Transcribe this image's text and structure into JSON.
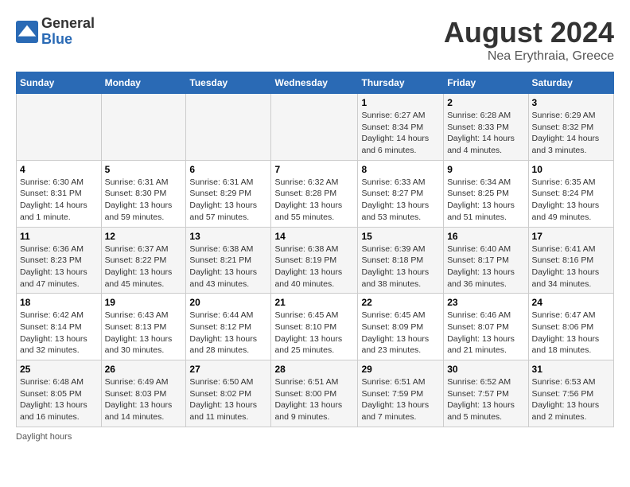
{
  "logo": {
    "general": "General",
    "blue": "Blue"
  },
  "title": "August 2024",
  "subtitle": "Nea Erythraia, Greece",
  "days_of_week": [
    "Sunday",
    "Monday",
    "Tuesday",
    "Wednesday",
    "Thursday",
    "Friday",
    "Saturday"
  ],
  "weeks": [
    [
      {
        "num": "",
        "info": ""
      },
      {
        "num": "",
        "info": ""
      },
      {
        "num": "",
        "info": ""
      },
      {
        "num": "",
        "info": ""
      },
      {
        "num": "1",
        "info": "Sunrise: 6:27 AM\nSunset: 8:34 PM\nDaylight: 14 hours and 6 minutes."
      },
      {
        "num": "2",
        "info": "Sunrise: 6:28 AM\nSunset: 8:33 PM\nDaylight: 14 hours and 4 minutes."
      },
      {
        "num": "3",
        "info": "Sunrise: 6:29 AM\nSunset: 8:32 PM\nDaylight: 14 hours and 3 minutes."
      }
    ],
    [
      {
        "num": "4",
        "info": "Sunrise: 6:30 AM\nSunset: 8:31 PM\nDaylight: 14 hours and 1 minute."
      },
      {
        "num": "5",
        "info": "Sunrise: 6:31 AM\nSunset: 8:30 PM\nDaylight: 13 hours and 59 minutes."
      },
      {
        "num": "6",
        "info": "Sunrise: 6:31 AM\nSunset: 8:29 PM\nDaylight: 13 hours and 57 minutes."
      },
      {
        "num": "7",
        "info": "Sunrise: 6:32 AM\nSunset: 8:28 PM\nDaylight: 13 hours and 55 minutes."
      },
      {
        "num": "8",
        "info": "Sunrise: 6:33 AM\nSunset: 8:27 PM\nDaylight: 13 hours and 53 minutes."
      },
      {
        "num": "9",
        "info": "Sunrise: 6:34 AM\nSunset: 8:25 PM\nDaylight: 13 hours and 51 minutes."
      },
      {
        "num": "10",
        "info": "Sunrise: 6:35 AM\nSunset: 8:24 PM\nDaylight: 13 hours and 49 minutes."
      }
    ],
    [
      {
        "num": "11",
        "info": "Sunrise: 6:36 AM\nSunset: 8:23 PM\nDaylight: 13 hours and 47 minutes."
      },
      {
        "num": "12",
        "info": "Sunrise: 6:37 AM\nSunset: 8:22 PM\nDaylight: 13 hours and 45 minutes."
      },
      {
        "num": "13",
        "info": "Sunrise: 6:38 AM\nSunset: 8:21 PM\nDaylight: 13 hours and 43 minutes."
      },
      {
        "num": "14",
        "info": "Sunrise: 6:38 AM\nSunset: 8:19 PM\nDaylight: 13 hours and 40 minutes."
      },
      {
        "num": "15",
        "info": "Sunrise: 6:39 AM\nSunset: 8:18 PM\nDaylight: 13 hours and 38 minutes."
      },
      {
        "num": "16",
        "info": "Sunrise: 6:40 AM\nSunset: 8:17 PM\nDaylight: 13 hours and 36 minutes."
      },
      {
        "num": "17",
        "info": "Sunrise: 6:41 AM\nSunset: 8:16 PM\nDaylight: 13 hours and 34 minutes."
      }
    ],
    [
      {
        "num": "18",
        "info": "Sunrise: 6:42 AM\nSunset: 8:14 PM\nDaylight: 13 hours and 32 minutes."
      },
      {
        "num": "19",
        "info": "Sunrise: 6:43 AM\nSunset: 8:13 PM\nDaylight: 13 hours and 30 minutes."
      },
      {
        "num": "20",
        "info": "Sunrise: 6:44 AM\nSunset: 8:12 PM\nDaylight: 13 hours and 28 minutes."
      },
      {
        "num": "21",
        "info": "Sunrise: 6:45 AM\nSunset: 8:10 PM\nDaylight: 13 hours and 25 minutes."
      },
      {
        "num": "22",
        "info": "Sunrise: 6:45 AM\nSunset: 8:09 PM\nDaylight: 13 hours and 23 minutes."
      },
      {
        "num": "23",
        "info": "Sunrise: 6:46 AM\nSunset: 8:07 PM\nDaylight: 13 hours and 21 minutes."
      },
      {
        "num": "24",
        "info": "Sunrise: 6:47 AM\nSunset: 8:06 PM\nDaylight: 13 hours and 18 minutes."
      }
    ],
    [
      {
        "num": "25",
        "info": "Sunrise: 6:48 AM\nSunset: 8:05 PM\nDaylight: 13 hours and 16 minutes."
      },
      {
        "num": "26",
        "info": "Sunrise: 6:49 AM\nSunset: 8:03 PM\nDaylight: 13 hours and 14 minutes."
      },
      {
        "num": "27",
        "info": "Sunrise: 6:50 AM\nSunset: 8:02 PM\nDaylight: 13 hours and 11 minutes."
      },
      {
        "num": "28",
        "info": "Sunrise: 6:51 AM\nSunset: 8:00 PM\nDaylight: 13 hours and 9 minutes."
      },
      {
        "num": "29",
        "info": "Sunrise: 6:51 AM\nSunset: 7:59 PM\nDaylight: 13 hours and 7 minutes."
      },
      {
        "num": "30",
        "info": "Sunrise: 6:52 AM\nSunset: 7:57 PM\nDaylight: 13 hours and 5 minutes."
      },
      {
        "num": "31",
        "info": "Sunrise: 6:53 AM\nSunset: 7:56 PM\nDaylight: 13 hours and 2 minutes."
      }
    ]
  ],
  "footer": "Daylight hours"
}
